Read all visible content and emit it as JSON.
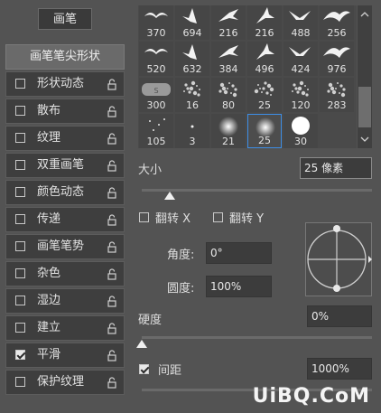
{
  "tab": {
    "label": "画笔"
  },
  "panel_header": "画笔笔尖形状",
  "options": [
    {
      "label": "形状动态",
      "checked": false
    },
    {
      "label": "散布",
      "checked": false
    },
    {
      "label": "纹理",
      "checked": false
    },
    {
      "label": "双重画笔",
      "checked": false
    },
    {
      "label": "颜色动态",
      "checked": false
    },
    {
      "label": "传递",
      "checked": false
    },
    {
      "label": "画笔笔势",
      "checked": false
    },
    {
      "label": "杂色",
      "checked": false
    },
    {
      "label": "湿边",
      "checked": false
    },
    {
      "label": "建立",
      "checked": false
    },
    {
      "label": "平滑",
      "checked": true
    },
    {
      "label": "保护纹理",
      "checked": false
    }
  ],
  "brushes": [
    {
      "size": "370",
      "icon": "bird-icon"
    },
    {
      "size": "694",
      "icon": "bird-icon"
    },
    {
      "size": "216",
      "icon": "bird-icon"
    },
    {
      "size": "216",
      "icon": "bird-icon"
    },
    {
      "size": "488",
      "icon": "bird-icon"
    },
    {
      "size": "256",
      "icon": "bird-icon"
    },
    {
      "size": "520",
      "icon": "bird-icon"
    },
    {
      "size": "632",
      "icon": "bird-icon"
    },
    {
      "size": "384",
      "icon": "bird-icon"
    },
    {
      "size": "496",
      "icon": "bird-icon"
    },
    {
      "size": "424",
      "icon": "bird-icon"
    },
    {
      "size": "976",
      "icon": "bird-icon"
    },
    {
      "size": "300",
      "icon": "texture-icon"
    },
    {
      "size": "16",
      "icon": "splatter-icon"
    },
    {
      "size": "80",
      "icon": "splatter-icon"
    },
    {
      "size": "25",
      "icon": "splatter-icon"
    },
    {
      "size": "120",
      "icon": "splatter-icon"
    },
    {
      "size": "283",
      "icon": "splatter-icon"
    },
    {
      "size": "105",
      "icon": "dots-icon"
    },
    {
      "size": "3",
      "icon": "dot-icon"
    },
    {
      "size": "21",
      "icon": "soft-round-icon"
    },
    {
      "size": "25",
      "icon": "soft-round-icon"
    },
    {
      "size": "30",
      "icon": "hard-round-icon"
    }
  ],
  "selected_brush_index": 21,
  "size": {
    "label": "大小",
    "value": "25 像素",
    "slider_fraction": 0.12
  },
  "flip": {
    "x_label": "翻转 X",
    "y_label": "翻转 Y"
  },
  "angle": {
    "label": "角度:",
    "value": "0°"
  },
  "roundness": {
    "label": "圆度:",
    "value": "100%"
  },
  "hardness": {
    "label": "硬度",
    "value": "0%",
    "slider_fraction": 0.0
  },
  "spacing": {
    "label": "间距",
    "value": "1000%",
    "checked": true
  },
  "watermark": "UiBQ.CoM"
}
